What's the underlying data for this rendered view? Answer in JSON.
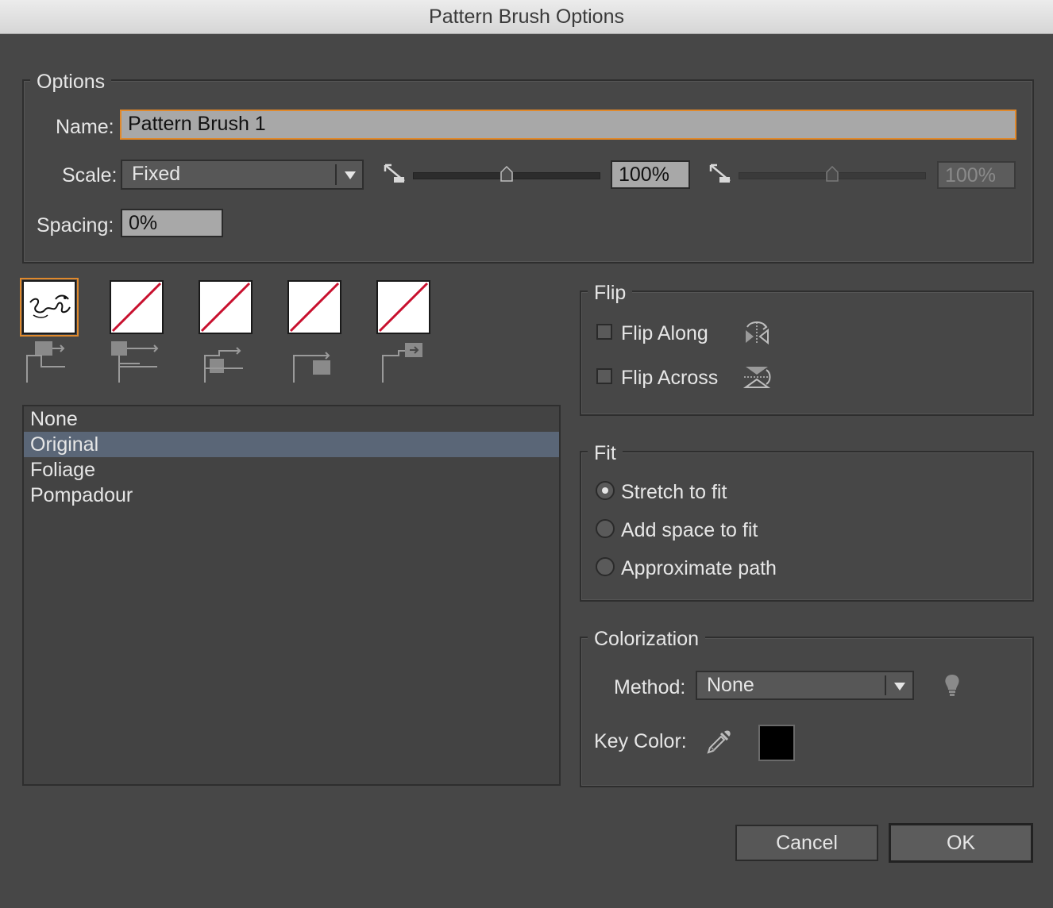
{
  "window": {
    "title": "Pattern Brush Options"
  },
  "options": {
    "legend": "Options",
    "name_label": "Name:",
    "name_value": "Pattern Brush 1",
    "scale_label": "Scale:",
    "scale_value": "Fixed",
    "scale_min_value": "100%",
    "scale_max_value": "100%",
    "spacing_label": "Spacing:",
    "spacing_value": "0%"
  },
  "tiles": {
    "items": [
      {
        "name": "side-tile",
        "selected": true
      },
      {
        "name": "outer-corner-tile",
        "selected": false
      },
      {
        "name": "inner-corner-tile",
        "selected": false
      },
      {
        "name": "start-tile",
        "selected": false
      },
      {
        "name": "end-tile",
        "selected": false
      }
    ]
  },
  "pattern_list": {
    "items": [
      "None",
      "Original",
      "Foliage",
      "Pompadour"
    ],
    "selected_index": 1
  },
  "flip": {
    "legend": "Flip",
    "along_label": "Flip Along",
    "across_label": "Flip Across"
  },
  "fit": {
    "legend": "Fit",
    "stretch_label": "Stretch to fit",
    "add_space_label": "Add space to fit",
    "approximate_label": "Approximate path",
    "selected": "Stretch to fit"
  },
  "colorization": {
    "legend": "Colorization",
    "method_label": "Method:",
    "method_value": "None",
    "key_color_label": "Key Color:",
    "key_color": "#000000"
  },
  "buttons": {
    "cancel": "Cancel",
    "ok": "OK"
  },
  "colors": {
    "accent": "#e0892c",
    "tile_none_slash": "#c8102e",
    "selection": "#5a6677"
  }
}
